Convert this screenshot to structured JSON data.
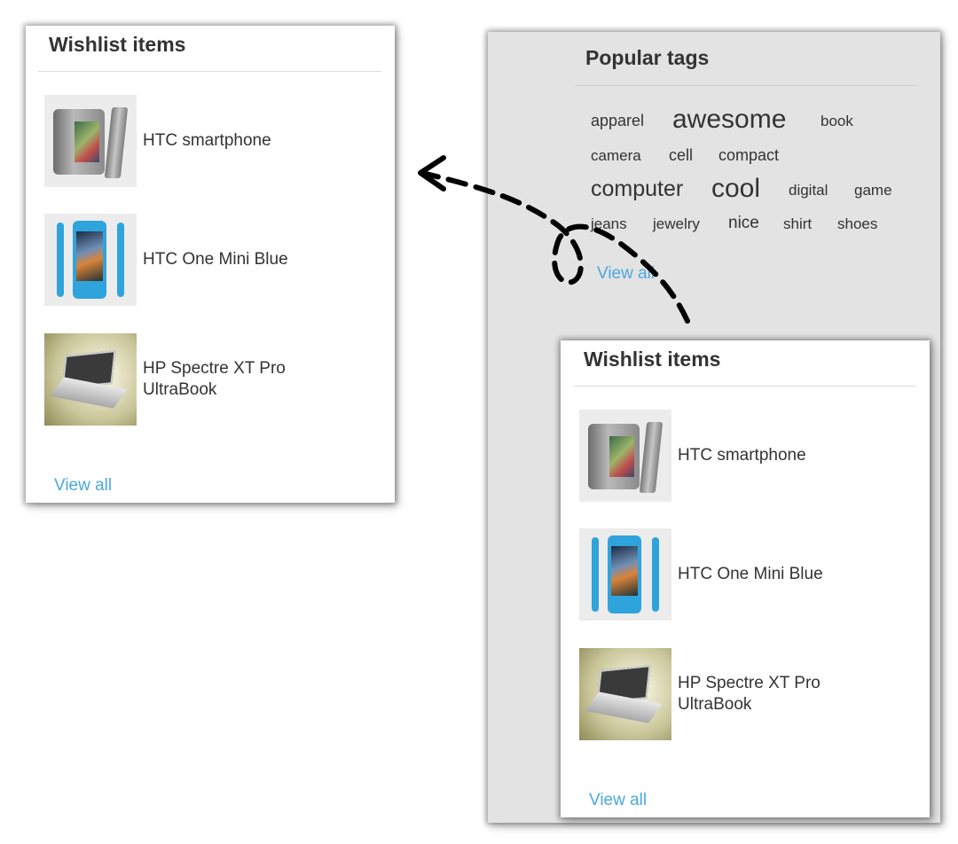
{
  "left_wishlist": {
    "title": "Wishlist items",
    "items": [
      {
        "name": "HTC smartphone",
        "image": "htc-smartphone-image"
      },
      {
        "name": "HTC One Mini Blue",
        "image": "htc-one-mini-blue-image"
      },
      {
        "name": "HP Spectre XT Pro UltraBook",
        "image": "hp-spectre-image"
      }
    ],
    "view_all": "View all"
  },
  "popular_tags": {
    "title": "Popular tags",
    "tags": [
      "apparel",
      "awesome",
      "book",
      "camera",
      "cell",
      "compact",
      "computer",
      "cool",
      "digital",
      "game",
      "jeans",
      "jewelry",
      "nice",
      "shirt",
      "shoes"
    ],
    "view_all": "View all"
  },
  "right_wishlist": {
    "title": "Wishlist items",
    "items": [
      {
        "name": "HTC smartphone",
        "image": "htc-smartphone-image"
      },
      {
        "name": "HTC One Mini Blue",
        "image": "htc-one-mini-blue-image"
      },
      {
        "name": "HP Spectre XT Pro UltraBook",
        "image": "hp-spectre-image"
      }
    ],
    "view_all": "View all"
  },
  "colors": {
    "link": "#4ba8dc",
    "text": "#333333",
    "tags_background": "#e3e3e3",
    "arrow": "#000000"
  },
  "annotation": {
    "icon": "dashed-loop-arrow-icon"
  }
}
